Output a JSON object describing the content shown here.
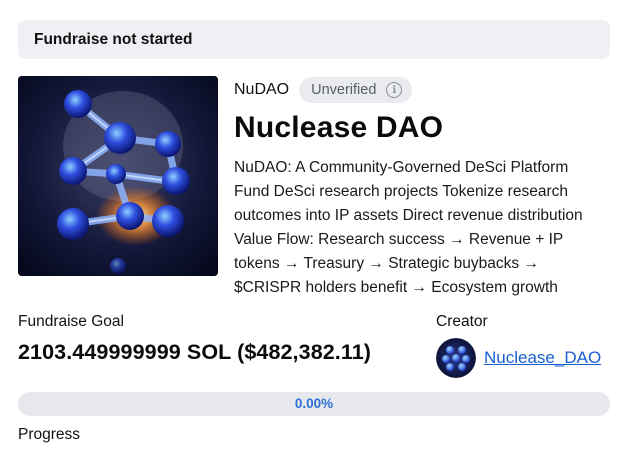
{
  "status": {
    "text": "Fundraise not started"
  },
  "project": {
    "short_name": "NuDAO",
    "verification": "Unverified",
    "info_icon": "info-icon",
    "title": "Nuclease DAO",
    "description": "NuDAO: A Community-Governed DeSci Platform\nFund DeSci research projects Tokenize research\noutcomes into IP assets Direct revenue distribution\nValue Flow: Research success → Revenue + IP\ntokens → Treasury → Strategic buybacks →\n$CRISPR holders benefit → Ecosystem growth"
  },
  "fundraise": {
    "goal_label": "Fundraise Goal",
    "goal_value": "2103.449999999 SOL ($482,382.11)"
  },
  "creator": {
    "label": "Creator",
    "name": "Nuclease_DAO"
  },
  "progress": {
    "percent": 0,
    "percent_text": "0.00%",
    "label": "Progress"
  },
  "colors": {
    "accent": "#3b7ddd",
    "link": "#1a5fd0",
    "badge_bg": "#e9ebee",
    "status_bg": "#eef0f3"
  }
}
